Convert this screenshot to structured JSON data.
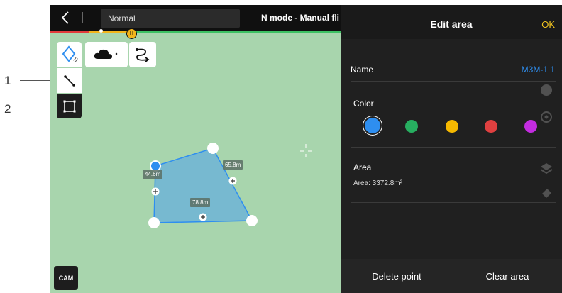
{
  "callouts": [
    {
      "number": "1"
    },
    {
      "number": "2"
    }
  ],
  "topbar": {
    "mode": "Normal",
    "title": "N mode - Manual fli",
    "home_marker": "H"
  },
  "map": {
    "edge_labels": {
      "left": "44.6m",
      "right": "65.8m",
      "bottom": "78.8m"
    }
  },
  "left_toolbar": {
    "tools": [
      {
        "icon": "polygon-icon"
      },
      {
        "icon": "line-icon"
      },
      {
        "icon": "rectangle-icon"
      }
    ],
    "obstacle_icon": "cloud-icon",
    "route_icon": "route-icon",
    "cam_label": "CAM"
  },
  "panel": {
    "title": "Edit area",
    "ok_label": "OK",
    "name_label": "Name",
    "name_value": "M3M-1 1",
    "color_label": "Color",
    "colors": [
      "#2e8ef0",
      "#27ae60",
      "#f5b800",
      "#e04040",
      "#c32ce0"
    ],
    "selected_color": "#2e8ef0",
    "area_label": "Area",
    "area_value": "Area: 3372.8m²",
    "delete_point_label": "Delete point",
    "clear_area_label": "Clear area"
  },
  "colors": {
    "map_background": "#a8d5ad",
    "polygon_fill": "#6fb4d6",
    "polygon_stroke": "#2e8ef0",
    "accent_ok": "#f0c320"
  }
}
